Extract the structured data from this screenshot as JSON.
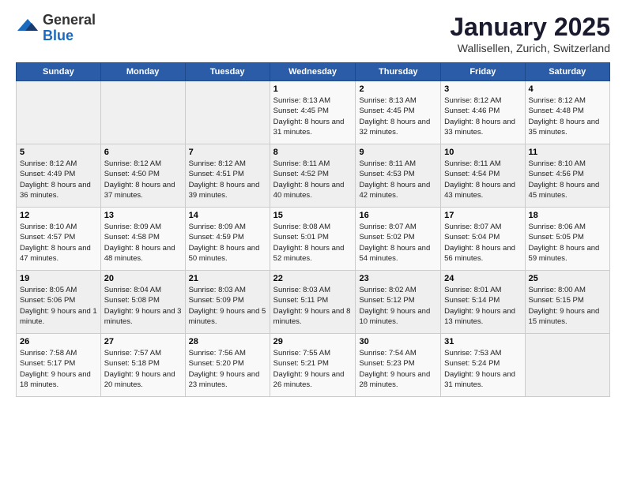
{
  "header": {
    "logo_general": "General",
    "logo_blue": "Blue",
    "month_title": "January 2025",
    "location": "Wallisellen, Zurich, Switzerland"
  },
  "weekdays": [
    "Sunday",
    "Monday",
    "Tuesday",
    "Wednesday",
    "Thursday",
    "Friday",
    "Saturday"
  ],
  "weeks": [
    [
      {
        "day": "",
        "sunrise": "",
        "sunset": "",
        "daylight": ""
      },
      {
        "day": "",
        "sunrise": "",
        "sunset": "",
        "daylight": ""
      },
      {
        "day": "",
        "sunrise": "",
        "sunset": "",
        "daylight": ""
      },
      {
        "day": "1",
        "sunrise": "8:13 AM",
        "sunset": "4:45 PM",
        "daylight": "8 hours and 31 minutes."
      },
      {
        "day": "2",
        "sunrise": "8:13 AM",
        "sunset": "4:45 PM",
        "daylight": "8 hours and 32 minutes."
      },
      {
        "day": "3",
        "sunrise": "8:12 AM",
        "sunset": "4:46 PM",
        "daylight": "8 hours and 33 minutes."
      },
      {
        "day": "4",
        "sunrise": "8:12 AM",
        "sunset": "4:48 PM",
        "daylight": "8 hours and 35 minutes."
      }
    ],
    [
      {
        "day": "5",
        "sunrise": "8:12 AM",
        "sunset": "4:49 PM",
        "daylight": "8 hours and 36 minutes."
      },
      {
        "day": "6",
        "sunrise": "8:12 AM",
        "sunset": "4:50 PM",
        "daylight": "8 hours and 37 minutes."
      },
      {
        "day": "7",
        "sunrise": "8:12 AM",
        "sunset": "4:51 PM",
        "daylight": "8 hours and 39 minutes."
      },
      {
        "day": "8",
        "sunrise": "8:11 AM",
        "sunset": "4:52 PM",
        "daylight": "8 hours and 40 minutes."
      },
      {
        "day": "9",
        "sunrise": "8:11 AM",
        "sunset": "4:53 PM",
        "daylight": "8 hours and 42 minutes."
      },
      {
        "day": "10",
        "sunrise": "8:11 AM",
        "sunset": "4:54 PM",
        "daylight": "8 hours and 43 minutes."
      },
      {
        "day": "11",
        "sunrise": "8:10 AM",
        "sunset": "4:56 PM",
        "daylight": "8 hours and 45 minutes."
      }
    ],
    [
      {
        "day": "12",
        "sunrise": "8:10 AM",
        "sunset": "4:57 PM",
        "daylight": "8 hours and 47 minutes."
      },
      {
        "day": "13",
        "sunrise": "8:09 AM",
        "sunset": "4:58 PM",
        "daylight": "8 hours and 48 minutes."
      },
      {
        "day": "14",
        "sunrise": "8:09 AM",
        "sunset": "4:59 PM",
        "daylight": "8 hours and 50 minutes."
      },
      {
        "day": "15",
        "sunrise": "8:08 AM",
        "sunset": "5:01 PM",
        "daylight": "8 hours and 52 minutes."
      },
      {
        "day": "16",
        "sunrise": "8:07 AM",
        "sunset": "5:02 PM",
        "daylight": "8 hours and 54 minutes."
      },
      {
        "day": "17",
        "sunrise": "8:07 AM",
        "sunset": "5:04 PM",
        "daylight": "8 hours and 56 minutes."
      },
      {
        "day": "18",
        "sunrise": "8:06 AM",
        "sunset": "5:05 PM",
        "daylight": "8 hours and 59 minutes."
      }
    ],
    [
      {
        "day": "19",
        "sunrise": "8:05 AM",
        "sunset": "5:06 PM",
        "daylight": "9 hours and 1 minute."
      },
      {
        "day": "20",
        "sunrise": "8:04 AM",
        "sunset": "5:08 PM",
        "daylight": "9 hours and 3 minutes."
      },
      {
        "day": "21",
        "sunrise": "8:03 AM",
        "sunset": "5:09 PM",
        "daylight": "9 hours and 5 minutes."
      },
      {
        "day": "22",
        "sunrise": "8:03 AM",
        "sunset": "5:11 PM",
        "daylight": "9 hours and 8 minutes."
      },
      {
        "day": "23",
        "sunrise": "8:02 AM",
        "sunset": "5:12 PM",
        "daylight": "9 hours and 10 minutes."
      },
      {
        "day": "24",
        "sunrise": "8:01 AM",
        "sunset": "5:14 PM",
        "daylight": "9 hours and 13 minutes."
      },
      {
        "day": "25",
        "sunrise": "8:00 AM",
        "sunset": "5:15 PM",
        "daylight": "9 hours and 15 minutes."
      }
    ],
    [
      {
        "day": "26",
        "sunrise": "7:58 AM",
        "sunset": "5:17 PM",
        "daylight": "9 hours and 18 minutes."
      },
      {
        "day": "27",
        "sunrise": "7:57 AM",
        "sunset": "5:18 PM",
        "daylight": "9 hours and 20 minutes."
      },
      {
        "day": "28",
        "sunrise": "7:56 AM",
        "sunset": "5:20 PM",
        "daylight": "9 hours and 23 minutes."
      },
      {
        "day": "29",
        "sunrise": "7:55 AM",
        "sunset": "5:21 PM",
        "daylight": "9 hours and 26 minutes."
      },
      {
        "day": "30",
        "sunrise": "7:54 AM",
        "sunset": "5:23 PM",
        "daylight": "9 hours and 28 minutes."
      },
      {
        "day": "31",
        "sunrise": "7:53 AM",
        "sunset": "5:24 PM",
        "daylight": "9 hours and 31 minutes."
      },
      {
        "day": "",
        "sunrise": "",
        "sunset": "",
        "daylight": ""
      }
    ]
  ]
}
